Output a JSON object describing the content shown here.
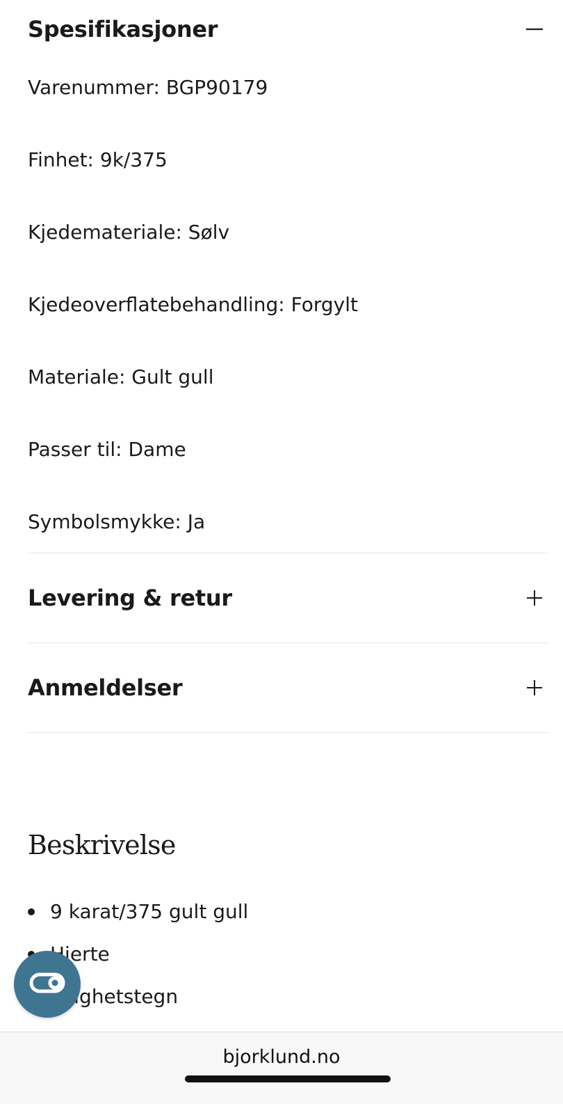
{
  "specifications": {
    "title": "Spesifikasjoner",
    "items": [
      "Varenummer: BGP90179",
      "Finhet: 9k/375",
      "Kjedemateriale: Sølv",
      "Kjedeoverflatebehandling: Forgylt",
      "Materiale: Gult gull",
      "Passer til: Dame",
      "Symbolsmykke: Ja"
    ]
  },
  "accordions": [
    {
      "title": "Levering & retur"
    },
    {
      "title": "Anmeldelser"
    }
  ],
  "description": {
    "title": "Beskrivelse",
    "items": [
      "9 karat/375 gult gull",
      "Hjerte",
      "Evighetstegn"
    ]
  },
  "browser": {
    "url": "bjorklund.no"
  },
  "colors": {
    "accent": "#3f7591",
    "text": "#1a1a1a",
    "divider": "#e6e6e6"
  },
  "icons": {
    "collapse": "minus-icon",
    "expand": "plus-icon",
    "fab": "accessibility-toggle-icon"
  }
}
